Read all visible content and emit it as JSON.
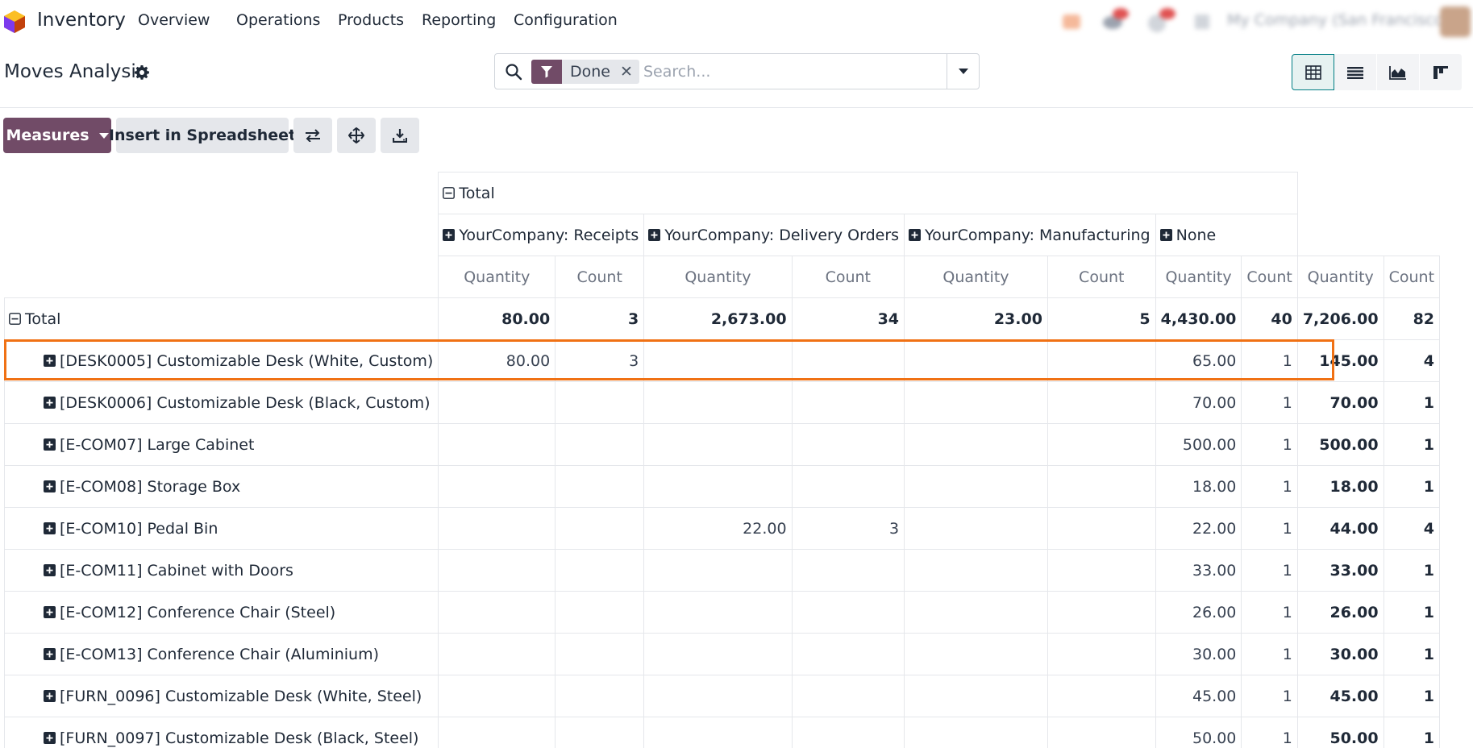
{
  "navbar": {
    "app_name": "Inventory",
    "menu": [
      "Overview",
      "Operations",
      "Products",
      "Reporting",
      "Configuration"
    ],
    "company": "My Company (San Francisco)",
    "brand_color": "#714b67"
  },
  "control_panel": {
    "title": "Moves Analysis",
    "search": {
      "facet_value": "Done",
      "placeholder": "Search..."
    },
    "views": [
      "pivot-icon",
      "list-icon",
      "graph-icon",
      "kanban-icon"
    ],
    "active_view": "pivot"
  },
  "buttons": {
    "measures": "Measures",
    "insert_spreadsheet": "Insert in Spreadsheet",
    "flip_axis": "flip-axis-icon",
    "expand_all": "expand-all-icon",
    "download": "download-icon"
  },
  "pivot": {
    "col_total_label": "Total",
    "col_groups": [
      "YourCompany: Receipts",
      "YourCompany: Delivery Orders",
      "YourCompany: Manufacturing",
      "None"
    ],
    "measures": [
      "Quantity",
      "Count"
    ],
    "row_total_label": "Total",
    "total_row": [
      "80.00",
      "3",
      "2,673.00",
      "34",
      "23.00",
      "5",
      "4,430.00",
      "40",
      "7,206.00",
      "82"
    ],
    "rows": [
      {
        "label": "[DESK0005] Customizable Desk (White, Custom)",
        "cells": [
          "80.00",
          "3",
          "",
          "",
          "",
          "",
          "65.00",
          "1",
          "145.00",
          "4"
        ]
      },
      {
        "label": "[DESK0006] Customizable Desk (Black, Custom)",
        "cells": [
          "",
          "",
          "",
          "",
          "",
          "",
          "70.00",
          "1",
          "70.00",
          "1"
        ]
      },
      {
        "label": "[E-COM07] Large Cabinet",
        "cells": [
          "",
          "",
          "",
          "",
          "",
          "",
          "500.00",
          "1",
          "500.00",
          "1"
        ]
      },
      {
        "label": "[E-COM08] Storage Box",
        "cells": [
          "",
          "",
          "",
          "",
          "",
          "",
          "18.00",
          "1",
          "18.00",
          "1"
        ]
      },
      {
        "label": "[E-COM10] Pedal Bin",
        "cells": [
          "",
          "",
          "22.00",
          "3",
          "",
          "",
          "22.00",
          "1",
          "44.00",
          "4"
        ]
      },
      {
        "label": "[E-COM11] Cabinet with Doors",
        "cells": [
          "",
          "",
          "",
          "",
          "",
          "",
          "33.00",
          "1",
          "33.00",
          "1"
        ]
      },
      {
        "label": "[E-COM12] Conference Chair (Steel)",
        "cells": [
          "",
          "",
          "",
          "",
          "",
          "",
          "26.00",
          "1",
          "26.00",
          "1"
        ]
      },
      {
        "label": "[E-COM13] Conference Chair (Aluminium)",
        "cells": [
          "",
          "",
          "",
          "",
          "",
          "",
          "30.00",
          "1",
          "30.00",
          "1"
        ]
      },
      {
        "label": "[FURN_0096] Customizable Desk (White, Steel)",
        "cells": [
          "",
          "",
          "",
          "",
          "",
          "",
          "45.00",
          "1",
          "45.00",
          "1"
        ]
      },
      {
        "label": "[FURN_0097] Customizable Desk (Black, Steel)",
        "cells": [
          "",
          "",
          "",
          "",
          "",
          "",
          "50.00",
          "1",
          "50.00",
          "1"
        ]
      }
    ],
    "highlighted_row": 0,
    "highlight_color": "#f07114"
  }
}
